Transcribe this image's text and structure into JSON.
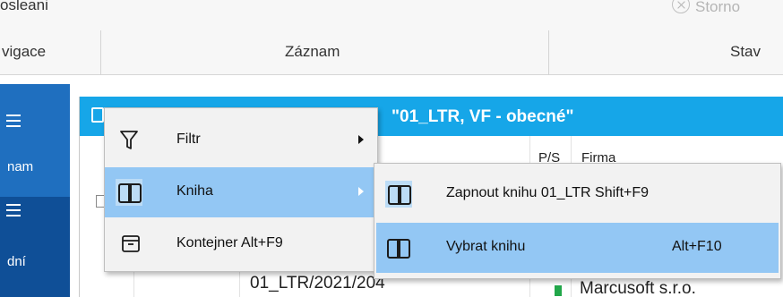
{
  "ribbon": {
    "top_cut_label": "osleani",
    "storno_label": "Storno",
    "groups": [
      "vigace",
      "Záznam",
      "Stav"
    ]
  },
  "nav": {
    "items": [
      {
        "label": "nam",
        "active": false
      },
      {
        "label": "dní",
        "active": true
      }
    ]
  },
  "window": {
    "title": "\"01_LTR, VF - obecné\"",
    "columns": [
      "P/S",
      "Firma"
    ],
    "row": {
      "code": "01_LTR/2021/204",
      "firm": "Marcusoft s.r.o."
    }
  },
  "context_menu": {
    "items": [
      {
        "icon": "filter-icon",
        "label": "Filtr",
        "has_submenu": true
      },
      {
        "icon": "book-icon",
        "label": "Kniha",
        "has_submenu": true,
        "highlighted": true
      },
      {
        "icon": "container-icon",
        "label": "Kontejner Alt+F9",
        "has_submenu": false
      }
    ]
  },
  "submenu": {
    "items": [
      {
        "icon": "book-icon",
        "label": "Zapnout knihu 01_LTR Shift+F9",
        "hotkey": ""
      },
      {
        "icon": "book-icon",
        "label": "Vybrat knihu",
        "hotkey": "Alt+F10",
        "highlighted": true
      }
    ]
  },
  "colors": {
    "title_bar": "#16a6e8",
    "nav": "#1f6fbf",
    "menu_highlight": "#93c7f4",
    "status_green": "#22a74a"
  }
}
